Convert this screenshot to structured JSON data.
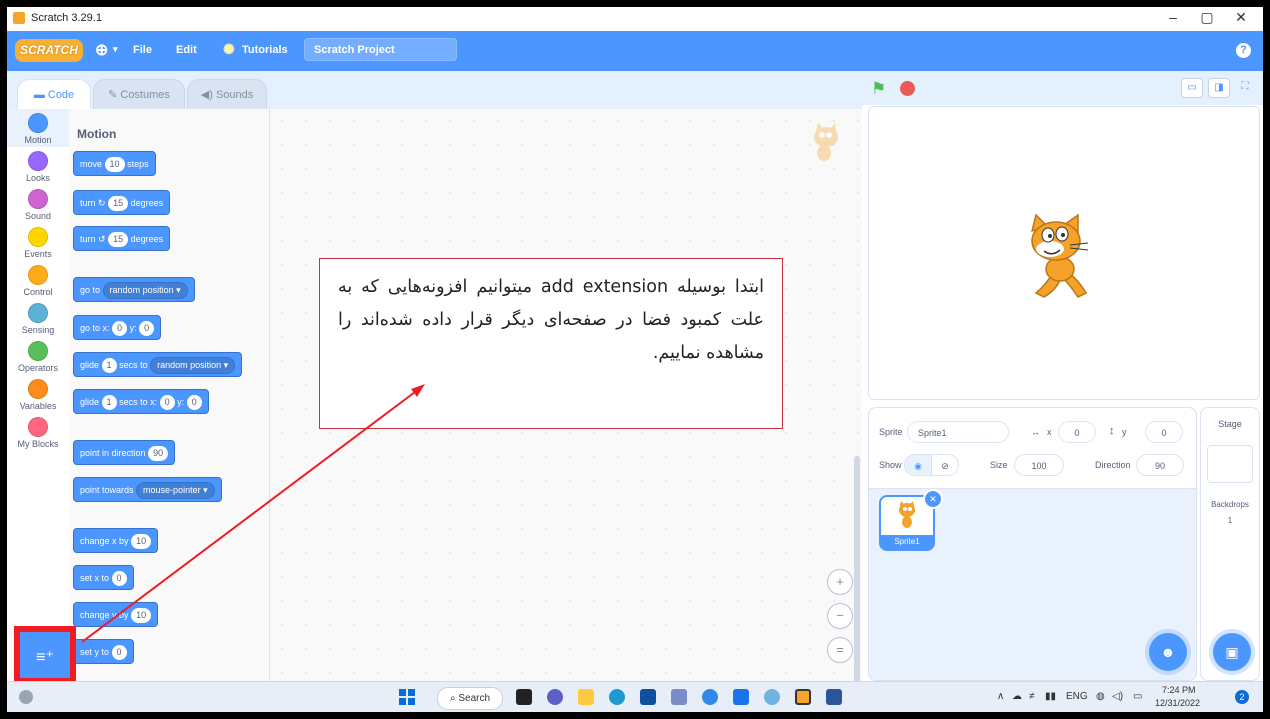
{
  "window": {
    "title": "Scratch 3.29.1",
    "minimize": "–",
    "restore": "▢",
    "close": "✕"
  },
  "menu": {
    "logo": "SCRATCH",
    "file": "File",
    "edit": "Edit",
    "tutorials": "Tutorials",
    "project_title": "Scratch Project",
    "help": "?"
  },
  "tabs": [
    {
      "label": "Code"
    },
    {
      "label": "Costumes"
    },
    {
      "label": "Sounds"
    }
  ],
  "categories": [
    {
      "label": "Motion",
      "color": "#4c97ff"
    },
    {
      "label": "Looks",
      "color": "#9966ff"
    },
    {
      "label": "Sound",
      "color": "#cf63cf"
    },
    {
      "label": "Events",
      "color": "#ffd500"
    },
    {
      "label": "Control",
      "color": "#ffab19"
    },
    {
      "label": "Sensing",
      "color": "#5cb1d6"
    },
    {
      "label": "Operators",
      "color": "#59c059"
    },
    {
      "label": "Variables",
      "color": "#ff8c1a"
    },
    {
      "label": "My Blocks",
      "color": "#ff6680"
    }
  ],
  "palette": {
    "title": "Motion",
    "blocks": {
      "move": {
        "pre": "move",
        "v": "10",
        "post": "steps"
      },
      "turn_right": {
        "pre": "turn",
        "icon": "↻",
        "v": "15",
        "post": "degrees"
      },
      "turn_left": {
        "pre": "turn",
        "icon": "↺",
        "v": "15",
        "post": "degrees"
      },
      "goto": {
        "pre": "go to",
        "dd": "random position ▾"
      },
      "goto_xy": {
        "pre": "go to x:",
        "x": "0",
        "mid": "y:",
        "y": "0"
      },
      "glide": {
        "pre": "glide",
        "v": "1",
        "mid": "secs to",
        "dd": "random position ▾"
      },
      "glide_xy": {
        "pre": "glide",
        "v": "1",
        "mid": "secs to x:",
        "x": "0",
        "mid2": "y:",
        "y": "0"
      },
      "point_dir": {
        "pre": "point in direction",
        "v": "90"
      },
      "point_towards": {
        "pre": "point towards",
        "dd": "mouse-pointer ▾"
      },
      "change_x": {
        "pre": "change x by",
        "v": "10"
      },
      "set_x": {
        "pre": "set x to",
        "v": "0"
      },
      "change_y": {
        "pre": "change y by",
        "v": "10"
      },
      "set_y": {
        "pre": "set y to",
        "v": "0"
      }
    }
  },
  "annotation": "ابتدا بوسیله add extension میتوانیم افزونه‌هایی که به علت کمبود فضا در صفحه‌ای دیگر قرار داده شده‌اند را مشاهده نماییم.",
  "zoom": {
    "in": "+",
    "out": "−",
    "reset": "="
  },
  "sprite": {
    "label": "Sprite",
    "name": "Sprite1",
    "x_label": "x",
    "x": "0",
    "y_label": "y",
    "y": "0",
    "show_label": "Show",
    "size_label": "Size",
    "size": "100",
    "direction_label": "Direction",
    "direction": "90",
    "thumb_label": "Sprite1"
  },
  "stage_panel": {
    "title": "Stage",
    "backdrops_label": "Backdrops",
    "backdrops_count": "1"
  },
  "taskbar": {
    "search": "Search",
    "lang": "ENG",
    "time": "7:24 PM",
    "date": "12/31/2022",
    "notif": "2"
  }
}
